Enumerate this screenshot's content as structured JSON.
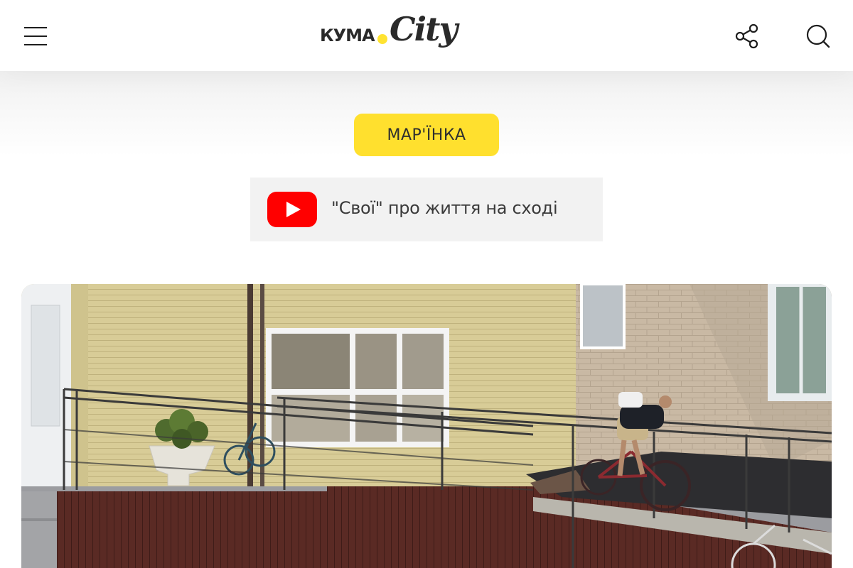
{
  "header": {
    "logo_prefix": "КУМА",
    "logo_script": "City"
  },
  "category": {
    "label": "МАР'ЇНКА"
  },
  "youtube": {
    "label": "\"Свої\" про життя на сході"
  },
  "icons": {
    "menu": "hamburger-menu-icon",
    "share": "share-icon",
    "search": "search-icon",
    "youtube": "youtube-icon"
  },
  "colors": {
    "accent_yellow": "#ffe02e",
    "youtube_red": "#ff0000",
    "text_dark": "#2a2a2a",
    "link_bg": "#f2f2f2"
  }
}
